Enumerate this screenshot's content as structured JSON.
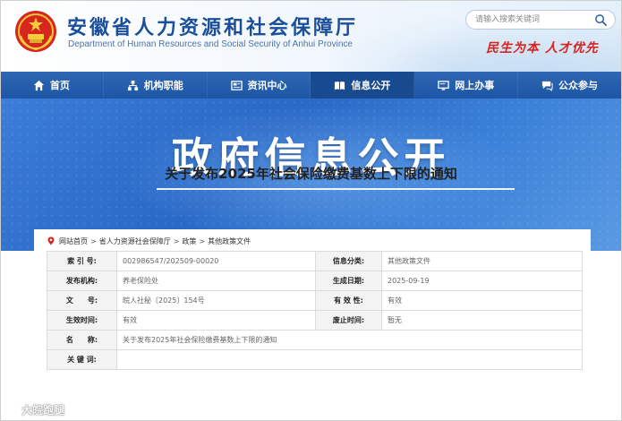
{
  "header": {
    "title": "安徽省人力资源和社会保障厅",
    "subtitle": "Department of Human Resources and Social Security of Anhui Province",
    "search_placeholder": "请输入搜索关键词",
    "slogan": "民生为本  人才优先"
  },
  "nav": {
    "items": [
      {
        "label": "首页",
        "icon": "home-icon"
      },
      {
        "label": "机构职能",
        "icon": "org-icon"
      },
      {
        "label": "资讯中心",
        "icon": "news-icon"
      },
      {
        "label": "信息公开",
        "icon": "book-icon",
        "active": true
      },
      {
        "label": "网上办事",
        "icon": "monitor-icon"
      },
      {
        "label": "公众参与",
        "icon": "chat-icon"
      }
    ]
  },
  "banner": {
    "title": "政府信息公开"
  },
  "breadcrumb": {
    "items": [
      "网站首页",
      "省人力资源社会保障厅",
      "政策",
      "其他政策文件"
    ],
    "separator": ">"
  },
  "info": {
    "index_label": "索 引 号:",
    "index_value": "002986547/202509-00020",
    "category_label": "信息分类:",
    "category_value": "其他政策文件",
    "publisher_label": "发布机构:",
    "publisher_value": "养老保险处",
    "date_label": "生成日期:",
    "date_value": "2025-09-19",
    "docno_label": "文　　号:",
    "docno_value": "皖人社秘〔2025〕154号",
    "validity_label": "有 效 性:",
    "validity_value": "有效",
    "effective_label": "生效时间:",
    "effective_value": "有效",
    "repeal_label": "废止时间:",
    "repeal_value": "暂无",
    "name_label": "名　　称:",
    "name_value": "关于发布2025年社会保险缴费基数上下限的通知",
    "keywords_label": "关 键 词:",
    "keywords_value": ""
  },
  "document": {
    "title": "关于发布2025年社会保险缴费基数上下限的通知"
  },
  "watermark": {
    "text": "大皖跑腿"
  },
  "colors": {
    "nav": "#1d56a5",
    "nav_active": "#174a8f",
    "title_blue": "#1a4f9c",
    "slogan_red": "#d8231f"
  }
}
